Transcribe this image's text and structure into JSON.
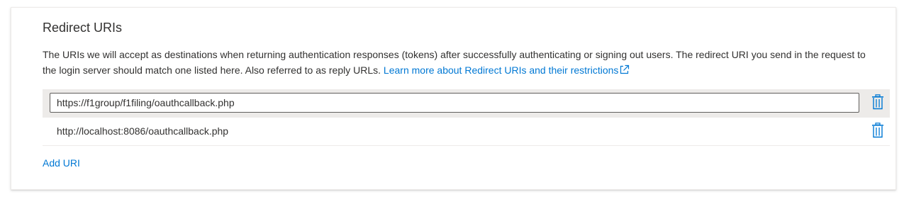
{
  "section": {
    "title": "Redirect URIs",
    "description": "The URIs we will accept as destinations when returning authentication responses (tokens) after successfully authenticating or signing out users. The redirect URI you send in the request to the login server should match one listed here. Also referred to as reply URLs.",
    "learn_more_link": "Learn more about Redirect URIs and their restrictions",
    "learn_more_icon": "external-link-icon"
  },
  "uris": [
    {
      "value": "https://f1group/f1filing/oauthcallback.php",
      "editing": true,
      "delete_icon": "trash-icon"
    },
    {
      "value": "http://localhost:8086/oauthcallback.php",
      "editing": false,
      "delete_icon": "trash-icon"
    }
  ],
  "add_uri_label": "Add URI",
  "colors": {
    "accent": "#0078d4",
    "text": "#323130",
    "selected_row": "#edebe9"
  }
}
